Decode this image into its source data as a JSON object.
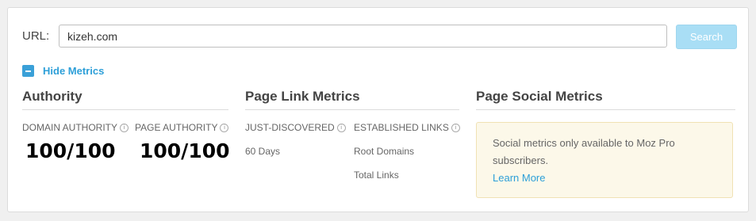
{
  "url_bar": {
    "label": "URL:",
    "value": "kizeh.com",
    "button_label": "Search"
  },
  "toggle": {
    "label": "Hide Metrics"
  },
  "authority": {
    "title": "Authority",
    "domain_authority_label": "DOMAIN AUTHORITY",
    "domain_authority_value": "100/100",
    "page_authority_label": "PAGE AUTHORITY",
    "page_authority_value": "100/100"
  },
  "page_link_metrics": {
    "title": "Page Link Metrics",
    "just_discovered_label": "JUST-DISCOVERED",
    "just_discovered_row": "60 Days",
    "established_links_label": "ESTABLISHED LINKS",
    "established_rows": [
      "Root Domains",
      "Total Links"
    ]
  },
  "page_social_metrics": {
    "title": "Page Social Metrics",
    "message": "Social metrics only available to Moz Pro subscribers.",
    "link_label": "Learn More"
  },
  "colors": {
    "accent": "#2d9fd8",
    "button_bg": "#a9def5",
    "notice_bg": "#fcf8e9"
  }
}
